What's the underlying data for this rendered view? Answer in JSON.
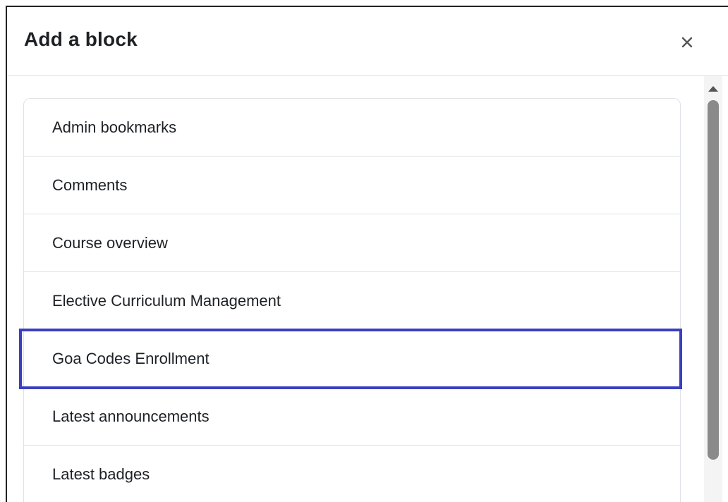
{
  "modal": {
    "title": "Add a block",
    "close_icon": "close-icon"
  },
  "block_list": {
    "items": [
      {
        "label": "Admin bookmarks"
      },
      {
        "label": "Comments"
      },
      {
        "label": "Course overview"
      },
      {
        "label": "Elective Curriculum Management"
      },
      {
        "label": "Goa Codes Enrollment",
        "highlighted": true
      },
      {
        "label": "Latest announcements"
      },
      {
        "label": "Latest badges"
      }
    ]
  },
  "colors": {
    "highlight_border": "#3a3fbf",
    "divider": "#dee2e6",
    "text": "#1d2125"
  }
}
